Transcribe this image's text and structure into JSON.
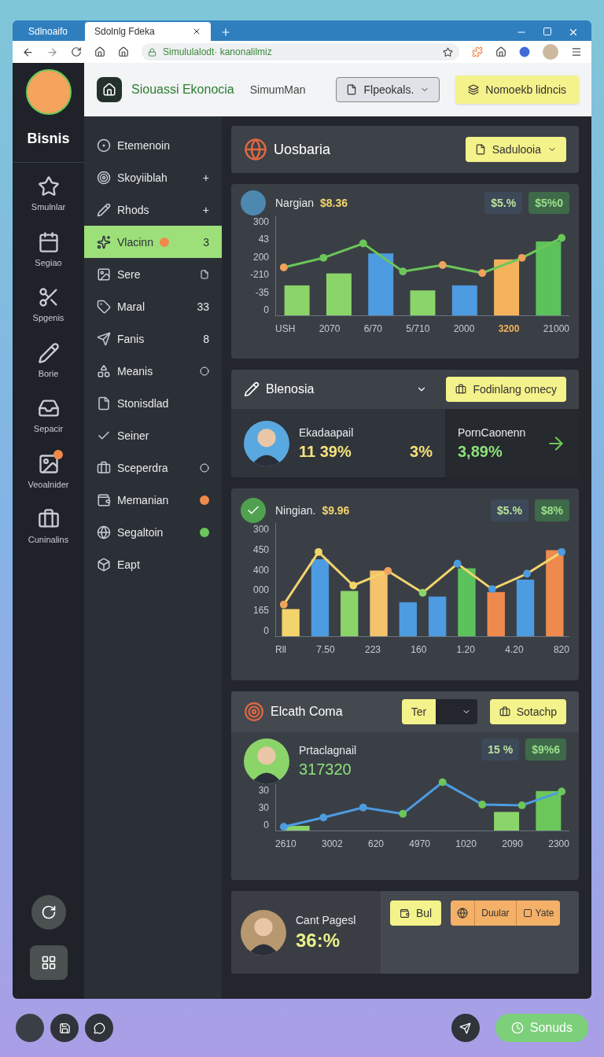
{
  "browser": {
    "tabs": [
      {
        "title": "Sdlnoaifo",
        "selected": false
      },
      {
        "title": "Sdolnlg Fdeka",
        "selected": true
      }
    ],
    "address": "Simululalodt· kanonalilmiz"
  },
  "rail": {
    "brand": "Bisnis",
    "items": [
      {
        "label": "Smulnlar",
        "badge": false
      },
      {
        "label": "Segiao",
        "badge": false
      },
      {
        "label": "Spgenis",
        "badge": false
      },
      {
        "label": "Borie",
        "badge": false
      },
      {
        "label": "Sepacir",
        "badge": false
      },
      {
        "label": "Veoalnider",
        "badge": true
      },
      {
        "label": "Cuninalins",
        "badge": false
      }
    ]
  },
  "header": {
    "title": "Siouassi Ekonocia",
    "subtitle": "SimumMan",
    "select": "Flpeokals.",
    "action": "Nomoekb lidncis"
  },
  "menu": [
    {
      "label": "Etemenoin",
      "selected": false
    },
    {
      "label": "Skoyiiblah",
      "selected": false,
      "trail": "+"
    },
    {
      "label": "Rhods",
      "selected": false,
      "trail": "+"
    },
    {
      "label": "Vlacinn",
      "selected": true,
      "trail": "3",
      "color": "#f08a4b"
    },
    {
      "label": "Sere",
      "selected": false
    },
    {
      "label": "Maral",
      "selected": false,
      "trail": "33"
    },
    {
      "label": "Fanis",
      "selected": false,
      "trail": "8"
    },
    {
      "label": "Meanis",
      "selected": false
    },
    {
      "label": "Stonisdlad",
      "selected": false
    },
    {
      "label": "Seiner",
      "selected": false
    },
    {
      "label": "Sceperdra",
      "selected": false
    },
    {
      "label": "Memanian",
      "selected": false,
      "color": "#f08a4b"
    },
    {
      "label": "Segaltoin",
      "selected": false,
      "color": "#6cc75a"
    },
    {
      "label": "Eapt",
      "selected": false
    }
  ],
  "overview": {
    "title": "Uosbaria",
    "button": "Sadulooia"
  },
  "chart_a": {
    "title": "Nargian",
    "value": "$8.36",
    "chips": [
      "$5.%",
      "$5%0"
    ],
    "y_labels": [
      "300",
      "43",
      "200",
      "-210",
      "-35",
      "0"
    ],
    "x_labels": [
      {
        "label": "USH",
        "highlighted": false
      },
      {
        "label": "2070",
        "highlighted": false
      },
      {
        "label": "6/70",
        "highlighted": false
      },
      {
        "label": "5/710",
        "highlighted": false
      },
      {
        "label": "2000",
        "highlighted": false
      },
      {
        "label": "3200",
        "highlighted": true
      },
      {
        "label": "21000",
        "highlighted": false
      }
    ]
  },
  "summary": {
    "title": "Blenosia",
    "button": "Fodinlang omecy",
    "name": "Ekadaapail",
    "value": "11 39%",
    "change": "3%",
    "side_label": "PornCaonenn",
    "side_value": "3,89%"
  },
  "chart_b": {
    "title": "Ningian.",
    "value": "$9.96",
    "chips": [
      "$5.%",
      "$8%"
    ],
    "y_labels": [
      "300",
      "450",
      "400",
      "000",
      "165",
      "0"
    ],
    "x_labels": [
      {
        "label": "Rll",
        "highlighted": false
      },
      {
        "label": "7.50",
        "highlighted": false
      },
      {
        "label": "223",
        "highlighted": false
      },
      {
        "label": "160",
        "highlighted": false
      },
      {
        "label": "1.20",
        "highlighted": false
      },
      {
        "label": "4.20",
        "highlighted": false
      },
      {
        "label": "820",
        "highlighted": false
      }
    ]
  },
  "report": {
    "title": "Elcath Coma",
    "dropdown": "Ter",
    "button": "Sotachp",
    "name": "Prtaclagnail",
    "value": "317320",
    "chips": [
      "15 %",
      "$9%6"
    ],
    "y_labels": [
      "30",
      "30",
      "0"
    ],
    "x_labels": [
      {
        "label": "2610",
        "highlighted": false
      },
      {
        "label": "3002",
        "highlighted": false
      },
      {
        "label": "620",
        "highlighted": false
      },
      {
        "label": "4970",
        "highlighted": false
      },
      {
        "label": "1020",
        "highlighted": false
      },
      {
        "label": "2090",
        "highlighted": false
      },
      {
        "label": "2300",
        "highlighted": false
      }
    ]
  },
  "profile": {
    "name": "Cant Pagesl",
    "value": "36:%",
    "button": "Bul",
    "segments": [
      "Duular",
      "Yate"
    ]
  },
  "footer": {
    "button": "Sonuds"
  }
}
